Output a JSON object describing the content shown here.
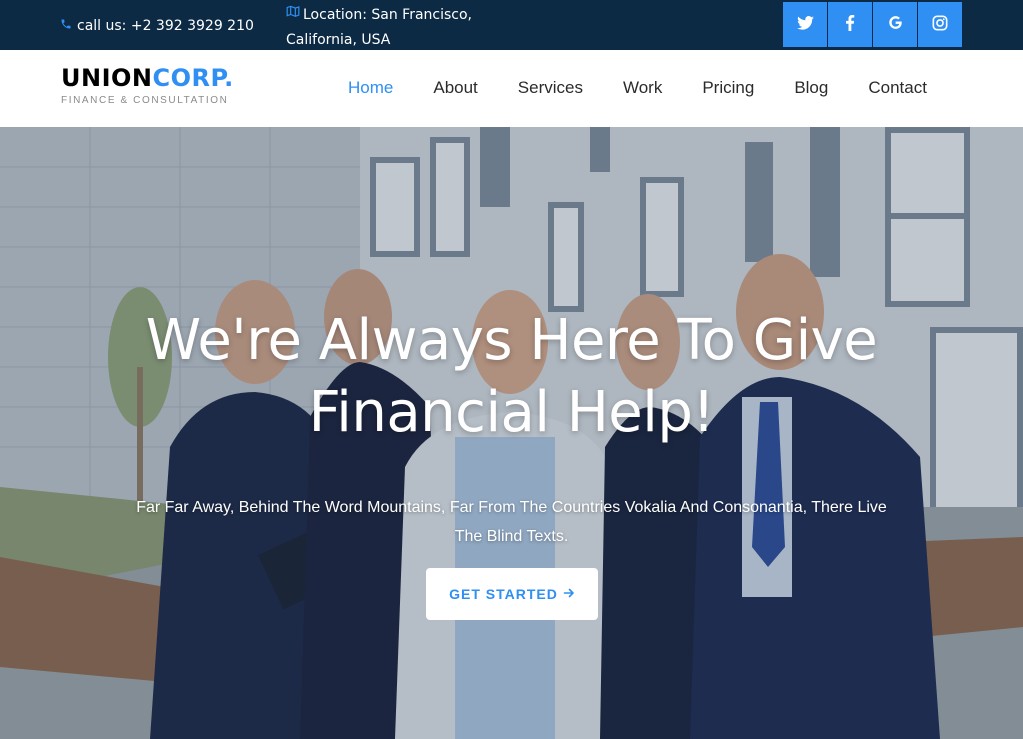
{
  "topbar": {
    "phone": "call us: +2 392 3929 210",
    "location_line1": "Location: San Francisco,",
    "location_line2": "California, USA",
    "phone_icon": "phone-icon",
    "location_icon": "map-icon",
    "social": [
      {
        "name": "twitter",
        "icon": "twitter-icon"
      },
      {
        "name": "facebook",
        "icon": "facebook-icon"
      },
      {
        "name": "google",
        "icon": "google-icon"
      },
      {
        "name": "instagram",
        "icon": "instagram-icon"
      }
    ]
  },
  "brand": {
    "name_part1": "UNION",
    "name_part2": "CORP.",
    "tagline": "FINANCE & CONSULTATION"
  },
  "nav": {
    "items": [
      "Home",
      "About",
      "Services",
      "Work",
      "Pricing",
      "Blog",
      "Contact"
    ],
    "active": "Home"
  },
  "hero": {
    "title_line1": "We're Always Here To Give",
    "title_line2": "Financial Help!",
    "subtitle_line1": "Far Far Away, Behind The Word Mountains, Far From The Countries Vokalia And Consonantia, There Live",
    "subtitle_line2": "The Blind Texts.",
    "cta_label": "GET STARTED",
    "cta_arrow": "arrow-right-icon"
  },
  "colors": {
    "topbar_bg": "#0d2a45",
    "accent": "#2f8ff2",
    "nav_text": "#2b2b2b",
    "tagline": "#8a8a8a"
  }
}
